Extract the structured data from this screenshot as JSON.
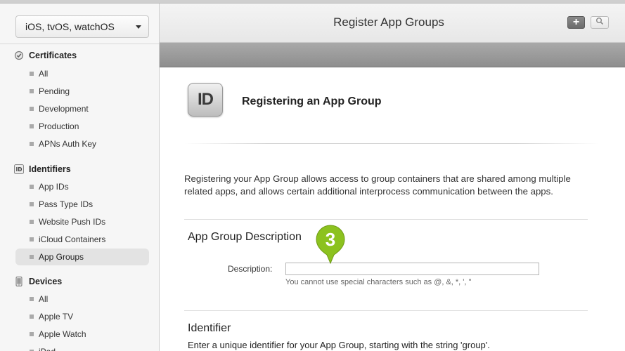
{
  "platform_select": {
    "value": "iOS, tvOS, watchOS"
  },
  "sidebar": {
    "certificates": {
      "title": "Certificates",
      "items": [
        "All",
        "Pending",
        "Development",
        "Production",
        "APNs Auth Key"
      ]
    },
    "identifiers": {
      "title": "Identifiers",
      "icon_text": "ID",
      "items": [
        "App IDs",
        "Pass Type IDs",
        "Website Push IDs",
        "iCloud Containers",
        "App Groups"
      ],
      "selected": "App Groups"
    },
    "devices": {
      "title": "Devices",
      "items": [
        "All",
        "Apple TV",
        "Apple Watch",
        "iPad"
      ]
    }
  },
  "header": {
    "title": "Register App Groups",
    "add_label": "+"
  },
  "main": {
    "icon_text": "ID",
    "heading": "Registering an App Group",
    "intro": "Registering your App Group allows access to group containers that are shared among multiple related apps, and allows certain additional interprocess communication between the apps.",
    "description_section": {
      "title": "App Group Description",
      "label": "Description:",
      "value": "",
      "hint": "You cannot use special characters such as @, &, *, ', \""
    },
    "identifier_section": {
      "title": "Identifier",
      "text": "Enter a unique identifier for your App Group, starting with the string 'group'."
    },
    "step_badge": "3"
  },
  "colors": {
    "badge": "#8cc21f",
    "selected_bg": "#e3e3e3",
    "toolbar": "#9a9a9a"
  },
  "icons": [
    "chevron-down-icon",
    "certificate-icon",
    "id-icon",
    "device-icon",
    "plus-icon",
    "search-icon"
  ]
}
